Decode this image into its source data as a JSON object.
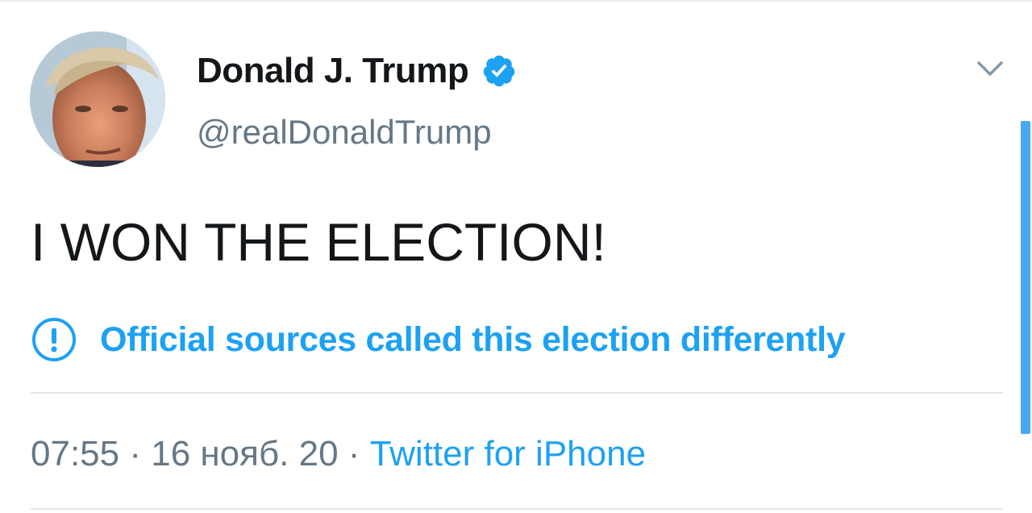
{
  "user": {
    "display_name": "Donald J. Trump",
    "handle": "@realDonaldTrump",
    "verified": true,
    "avatar_icon": "profile-photo"
  },
  "tweet": {
    "text": "I WON THE ELECTION!",
    "notice": {
      "icon": "exclamation-circle-icon",
      "text": "Official sources called this election differently"
    },
    "meta": {
      "time": "07:55",
      "separator": " · ",
      "date": "16 нояб. 20",
      "source": "Twitter for iPhone"
    }
  },
  "icons": {
    "verified": "verified-badge-icon",
    "menu": "chevron-down-icon"
  },
  "colors": {
    "accent": "#1da1f2",
    "text_primary": "#14171a",
    "text_secondary": "#657786",
    "divider": "#e1e8ed"
  }
}
